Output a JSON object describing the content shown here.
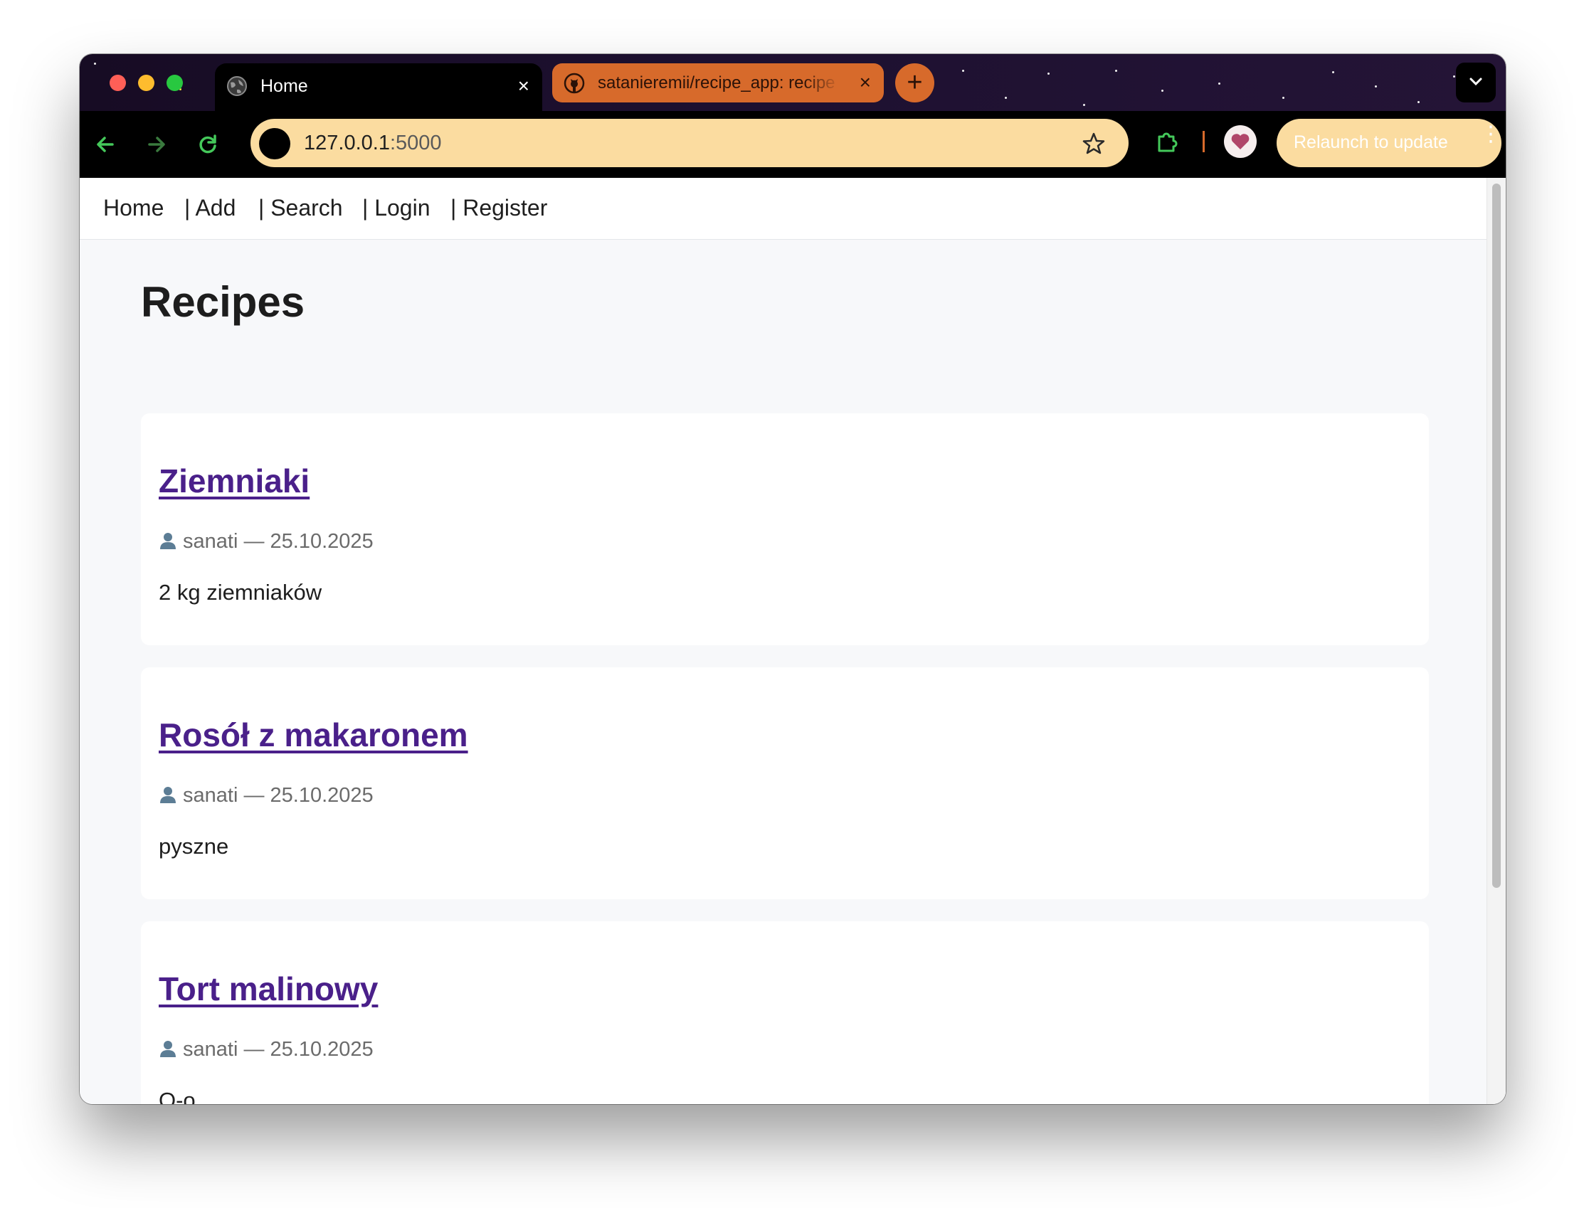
{
  "browser": {
    "tabs": [
      {
        "title": "Home",
        "icon": "globe-icon",
        "active": true
      },
      {
        "title": "satanieremii/recipe_app: recipe app",
        "icon": "github-icon",
        "active": false
      }
    ],
    "new_tab_label": "+",
    "url_host": "127.0.0.1",
    "url_port": ":5000",
    "relaunch_label": "Relaunch to update",
    "accent_color": "#d76a2b",
    "omnibox_color": "#fbdca0"
  },
  "site": {
    "nav": [
      "Home",
      "| Add",
      "| Search",
      "| Login",
      "| Register"
    ],
    "page_title": "Recipes",
    "recipes": [
      {
        "title": "Ziemniaki",
        "meta": "sanati — 25.10.2025",
        "description": "2 kg ziemniaków"
      },
      {
        "title": "Rosół z makaronem",
        "meta": "sanati — 25.10.2025",
        "description": "pyszne"
      },
      {
        "title": "Tort malinowy",
        "meta": "sanati — 25.10.2025",
        "description": "O-o"
      }
    ],
    "link_color": "#4a208a"
  }
}
